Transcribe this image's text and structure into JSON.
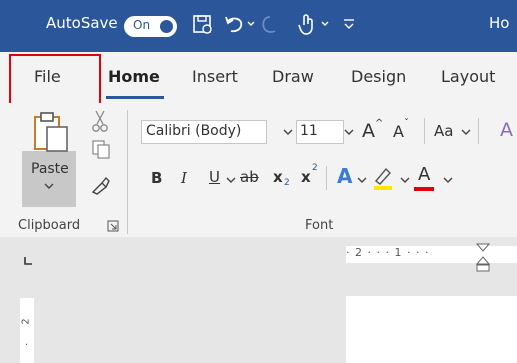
{
  "titlebar": {
    "autosave_label": "AutoSave",
    "autosave_state": "On",
    "doc_title_partial": "Ho"
  },
  "tabs": [
    {
      "label": "File"
    },
    {
      "label": "Home",
      "active": true
    },
    {
      "label": "Insert"
    },
    {
      "label": "Draw"
    },
    {
      "label": "Design"
    },
    {
      "label": "Layout"
    }
  ],
  "clipboard": {
    "paste_label": "Paste",
    "group_label": "Clipboard"
  },
  "font": {
    "font_name": "Calibri (Body)",
    "font_size": "11",
    "group_label": "Font",
    "grow_glyph": "A",
    "shrink_glyph": "A",
    "case_glyph": "Aa",
    "bold": "B",
    "italic": "I",
    "underline": "U",
    "strike": "ab",
    "sub": "x",
    "sup": "x",
    "effects": "A",
    "highlight_glyph": "",
    "color_glyph": "A"
  },
  "ruler": {
    "ticks": "· 2 · · · 1 · · ·"
  },
  "colors": {
    "accent": "#2b579a",
    "highlight_box": "#e3000f",
    "font_color": "#e3000f",
    "highlight_yellow": "#ffe600"
  }
}
